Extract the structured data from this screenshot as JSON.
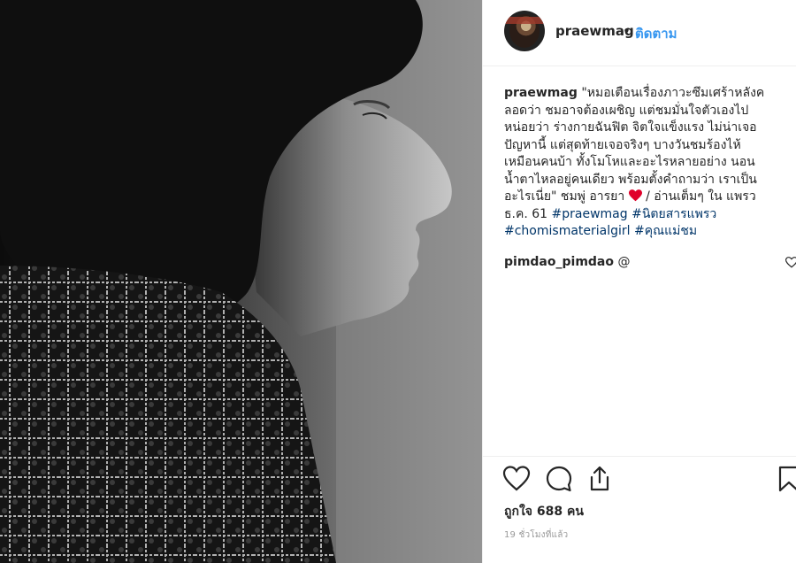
{
  "post": {
    "username": "praewmag",
    "separator": "•",
    "follow_label": "ติดตาม",
    "caption_lines": [
      "\"หมอเตือนเรื่องภาวะซึมเศร้าหลังค",
      "ลอดว่า ชมอาจต้องเผชิญ แต่ชมมั่นใจตัวเองไป",
      "หน่อยว่า ร่างกายฉันฟิต จิตใจแข็งแรง ไม่น่าเจอ",
      "ปัญหานี้ แต่สุดท้ายเจอจริงๆ บางวันชมร้องไห้",
      "เหมือนคนบ้า ทั้งโมโหและอะไรหลายอย่าง นอน",
      "น้ำตาไหลอยู่คนเดียว พร้อมตั้งคำถามว่า เราเป็น"
    ],
    "caption_line7_before": "อะไรเนี่ย\" ชมพู่ อารยา ",
    "caption_line7_after": " / อ่านเต็มๆ ใน แพรว",
    "caption_line8_text": "ธ.ค. 61 ",
    "hashtags": [
      "#praewmag",
      "#นิตยสารแพรว",
      "#chomismaterialgirl",
      "#คุณแม่ชม"
    ],
    "heart_color": "#e0002a"
  },
  "comment": {
    "username": "pimdao_pimdao",
    "text": " @"
  },
  "actions": {
    "icons": [
      "heart-icon",
      "comment-icon",
      "share-icon",
      "bookmark-icon"
    ]
  },
  "likes_text": "ถูกใจ 688 คน",
  "timestamp": "19 ชั่วโมงที่แล้ว",
  "colors": {
    "link": "#3897f0",
    "hashtag": "#003569",
    "text": "#262626",
    "muted": "#999999"
  }
}
